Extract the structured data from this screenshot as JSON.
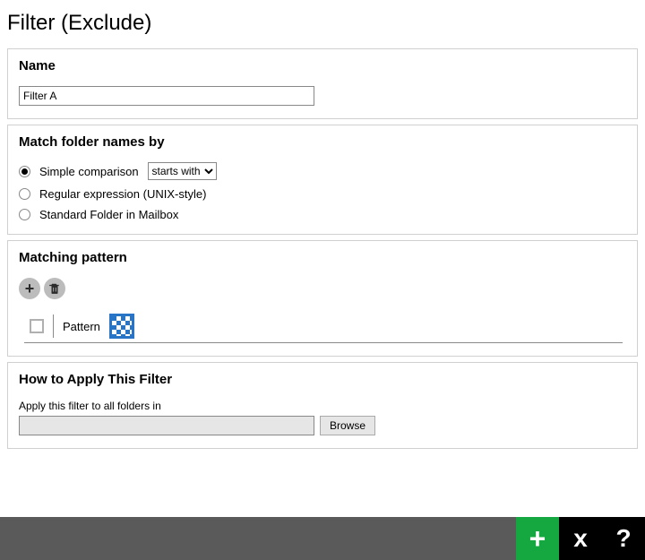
{
  "page_title": "Filter (Exclude)",
  "name_panel": {
    "heading": "Name",
    "value": "Filter A"
  },
  "match_panel": {
    "heading": "Match folder names by",
    "options": {
      "simple": "Simple comparison",
      "regex": "Regular expression (UNIX-style)",
      "standard": "Standard Folder in Mailbox"
    },
    "selected": "simple",
    "comparison_options": [
      "starts with"
    ],
    "comparison_selected": "starts with"
  },
  "pattern_panel": {
    "heading": "Matching pattern",
    "column_label": "Pattern"
  },
  "apply_panel": {
    "heading": "How to Apply This Filter",
    "label": "Apply this filter to all folders in",
    "value": "",
    "browse_label": "Browse"
  },
  "footer": {
    "add_glyph": "+",
    "cancel_glyph": "x",
    "help_glyph": "?"
  }
}
